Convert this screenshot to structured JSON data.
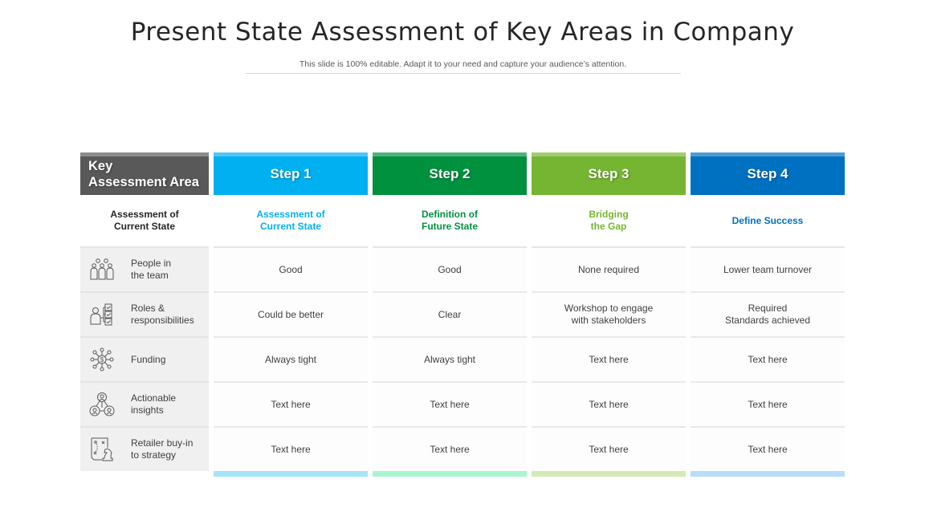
{
  "title": "Present State Assessment of Key Areas in Company",
  "subtitle": "This slide is 100% editable. Adapt it to your need and capture your audience’s attention.",
  "key_column": {
    "header": [
      "Key",
      "Assessment Area"
    ],
    "subheader": [
      "Assessment of",
      "Current State"
    ],
    "header_color": "#595959",
    "rows": [
      {
        "icon": "people-team-icon",
        "label": [
          "People in",
          "the team"
        ]
      },
      {
        "icon": "roles-checklist-icon",
        "label": [
          "Roles &",
          "responsibilities"
        ]
      },
      {
        "icon": "funding-network-icon",
        "label": [
          "Funding"
        ]
      },
      {
        "icon": "insights-network-icon",
        "label": [
          "Actionable",
          "insights"
        ]
      },
      {
        "icon": "strategy-chess-icon",
        "label": [
          "Retailer buy-in",
          "to strategy"
        ]
      }
    ]
  },
  "steps": [
    {
      "label": "Step 1",
      "color": "#00b0f0",
      "strip": "#4dc8f5",
      "bar": "#a6e4fa",
      "subheader": [
        "Assessment of",
        "Current State"
      ],
      "cells": [
        [
          "Good"
        ],
        [
          "Could be better"
        ],
        [
          "Always tight"
        ],
        [
          "Text here"
        ],
        [
          "Text here"
        ]
      ]
    },
    {
      "label": "Step 2",
      "color": "#00913f",
      "strip": "#4db37a",
      "bar": "#aaf5cf",
      "subheader": [
        "Definition of",
        "Future State"
      ],
      "cells": [
        [
          "Good"
        ],
        [
          "Clear"
        ],
        [
          "Always tight"
        ],
        [
          "Text here"
        ],
        [
          "Text here"
        ]
      ]
    },
    {
      "label": "Step 3",
      "color": "#76b531",
      "strip": "#a0cc6f",
      "bar": "#d3eab6",
      "subheader": [
        "Bridging",
        "the Gap"
      ],
      "cells": [
        [
          "None required"
        ],
        [
          "Workshop to engage",
          "with stakeholders"
        ],
        [
          "Text here"
        ],
        [
          "Text here"
        ],
        [
          "Text here"
        ]
      ]
    },
    {
      "label": "Step 4",
      "color": "#0070c0",
      "strip": "#4d9bd3",
      "bar": "#b8dcfa",
      "subheader": [
        "Define Success"
      ],
      "cells": [
        [
          "Lower team turnover"
        ],
        [
          "Required",
          "Standards achieved"
        ],
        [
          "Text here"
        ],
        [
          "Text here"
        ],
        [
          "Text here"
        ]
      ]
    }
  ]
}
